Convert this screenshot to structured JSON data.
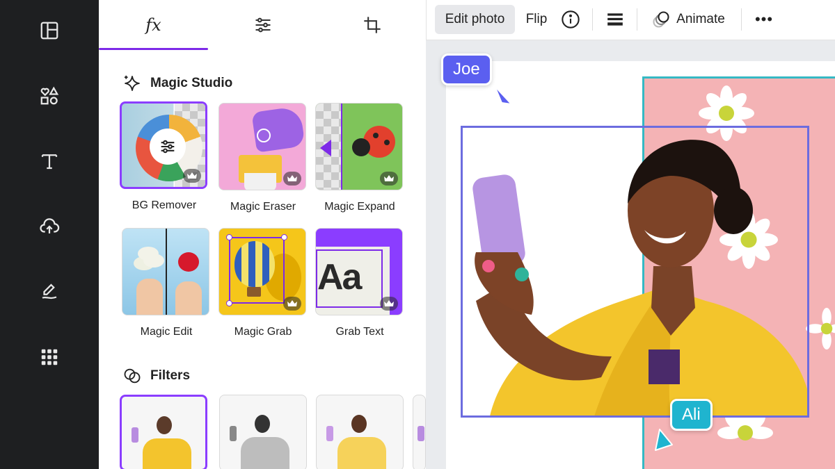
{
  "rail": {
    "items": [
      {
        "icon": "layout-icon"
      },
      {
        "icon": "elements-icon"
      },
      {
        "icon": "text-icon"
      },
      {
        "icon": "upload-icon"
      },
      {
        "icon": "draw-icon"
      },
      {
        "icon": "apps-icon"
      }
    ]
  },
  "panel": {
    "tabs": [
      {
        "label": "fx",
        "icon": "effects-icon",
        "active": true
      },
      {
        "icon": "adjust-icon"
      },
      {
        "icon": "crop-icon"
      }
    ],
    "magic_studio": {
      "title": "Magic Studio",
      "tools": [
        {
          "label": "BG Remover",
          "selected": true
        },
        {
          "label": "Magic Eraser"
        },
        {
          "label": "Magic Expand"
        },
        {
          "label": "Magic Edit"
        },
        {
          "label": "Magic Grab"
        },
        {
          "label": "Grab Text"
        }
      ],
      "grab_text_sample": "Aa"
    },
    "filters": {
      "title": "Filters"
    }
  },
  "toolbar": {
    "edit_photo": "Edit photo",
    "flip": "Flip",
    "animate": "Animate",
    "more": "•••"
  },
  "canvas": {
    "collaborators": [
      {
        "name": "Joe",
        "color": "#5b5ff0"
      },
      {
        "name": "Ali",
        "color": "#1fb4cf"
      }
    ]
  },
  "colors": {
    "accent": "#7d2ae8",
    "selection": "#6c6cdf",
    "rail_bg": "#1e1f21"
  }
}
